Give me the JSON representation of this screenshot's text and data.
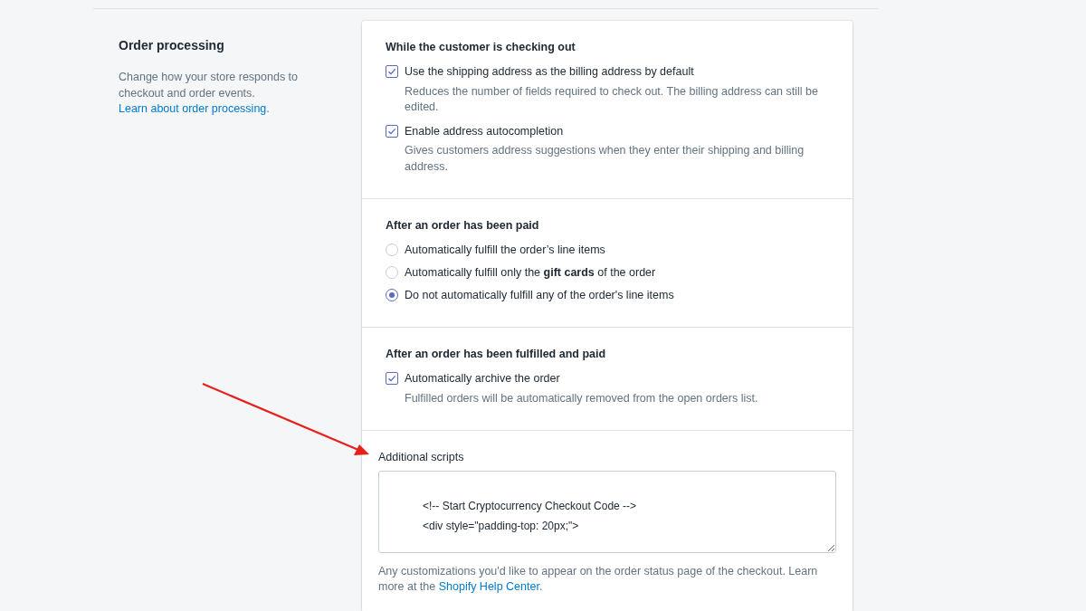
{
  "intro": {
    "title": "Order processing",
    "text": "Change how your store responds to checkout and order events.",
    "link": "Learn about order processing",
    "after": "."
  },
  "sections": [
    {
      "heading": "While the customer is checking out",
      "kind": "checkbox",
      "options": [
        {
          "label": "Use the shipping address as the billing address by default",
          "help": "Reduces the number of fields required to check out. The billing address can still be edited.",
          "checked": true
        },
        {
          "label": "Enable address autocompletion",
          "help": "Gives customers address suggestions when they enter their shipping and billing address.",
          "checked": true
        }
      ]
    },
    {
      "heading": "After an order has been paid",
      "kind": "radio",
      "options": [
        {
          "label": "Automatically fulfill the order’s line items",
          "selected": false
        },
        {
          "label": "Automatically fulfill only the **gift cards** of the order",
          "selected": false
        },
        {
          "label": "Do not automatically fulfill any of the order's line items",
          "selected": true
        }
      ]
    },
    {
      "heading": "After an order has been fulfilled and paid",
      "kind": "checkbox",
      "options": [
        {
          "label": "Automatically archive the order",
          "help": "Fulfilled orders will be automatically removed from the open orders list.",
          "checked": true
        }
      ]
    }
  ],
  "scripts": {
    "label": "Additional scripts",
    "lines": [
      "<!-- Start Cryptocurrency Checkout Code -->",
      "<div style=\"padding-top: 20px;\">"
    ],
    "help": "Any customizations you'd like to appear on the order status page of the checkout. Learn more at the",
    "link": "Shopify Help Center",
    "after": "."
  },
  "annotation": {
    "kind": "arrow"
  }
}
